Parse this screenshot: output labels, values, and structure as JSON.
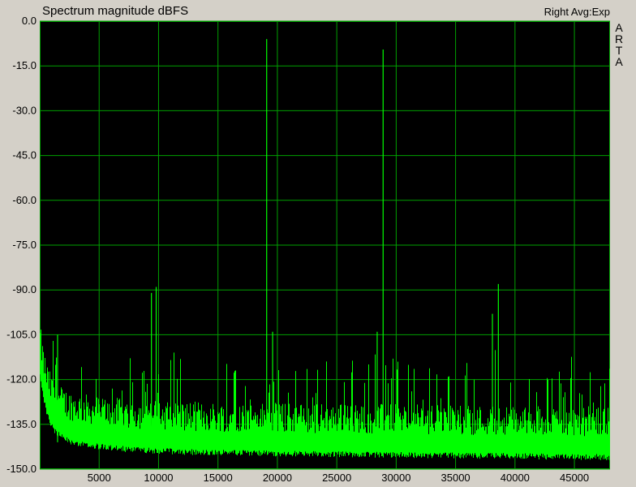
{
  "chart_data": {
    "type": "line",
    "title": "Spectrum magnitude dBFS",
    "mode_label": "Right Avg:Exp",
    "brand_letters": [
      "A",
      "R",
      "T",
      "A"
    ],
    "xlim": [
      0,
      48000
    ],
    "ylim": [
      -150,
      0
    ],
    "x_ticks": [
      5000,
      10000,
      15000,
      20000,
      25000,
      30000,
      35000,
      40000,
      45000
    ],
    "y_ticks": [
      "0.0",
      "-15.0",
      "-30.0",
      "-45.0",
      "-60.0",
      "-75.0",
      "-90.0",
      "-105.0",
      "-120.0",
      "-135.0",
      "-150.0"
    ],
    "y_tick_values": [
      0,
      -15,
      -30,
      -45,
      -60,
      -75,
      -90,
      -105,
      -120,
      -135,
      -150
    ],
    "grid": true,
    "background": "#000000",
    "grid_color": "#00a000",
    "trace_color": "#00ff00",
    "noise_floor_db": -141,
    "peaks": [
      {
        "x": 19100,
        "y": -6
      },
      {
        "x": 28900,
        "y": -9.5
      },
      {
        "x": 9400,
        "y": -91
      },
      {
        "x": 9800,
        "y": -89
      },
      {
        "x": 38600,
        "y": -88
      },
      {
        "x": 38100,
        "y": -98
      },
      {
        "x": 1500,
        "y": -105
      },
      {
        "x": 19600,
        "y": -104
      },
      {
        "x": 28400,
        "y": -104
      }
    ]
  }
}
